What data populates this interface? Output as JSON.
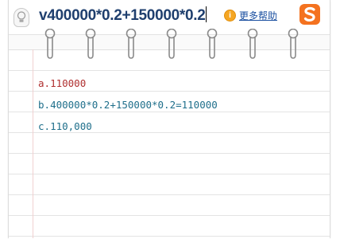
{
  "input": {
    "query": "v400000*0.2+150000*0.2"
  },
  "toolbar": {
    "help_label": "更多帮助",
    "help_icon": "info-icon",
    "logo_icon": "sogou-s-logo",
    "bulb_icon": "lightbulb-icon"
  },
  "candidates": [
    {
      "index": "a.",
      "text": "110000"
    },
    {
      "index": "b.",
      "text": "400000*0.2+150000*0.2=110000"
    },
    {
      "index": "c.",
      "text": "110,000"
    }
  ],
  "colors": {
    "query": "#1f3f6e",
    "candidate_highlight": "#b03030",
    "candidate_normal": "#1f6f8b",
    "logo": "#f4721f"
  }
}
